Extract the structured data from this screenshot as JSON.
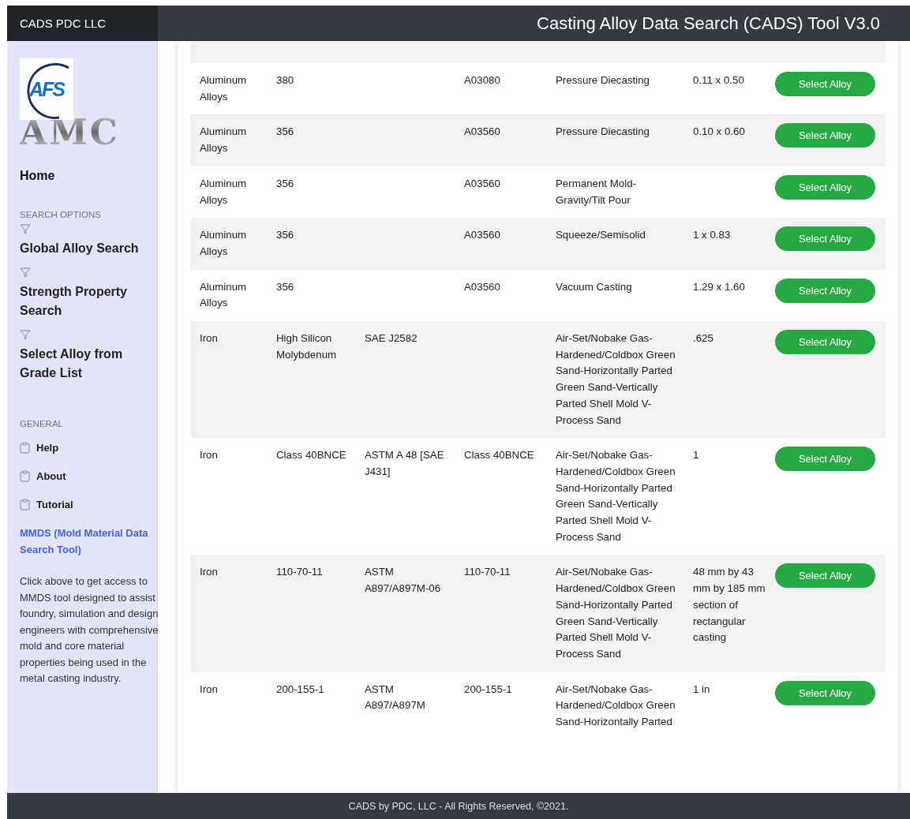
{
  "brand": "CADS PDC LLC",
  "title": "Casting Alloy Data Search (CADS) Tool V3.0",
  "logo": {
    "badge": "AFS",
    "wordmark": "AMC"
  },
  "sidebar": {
    "home": "Home",
    "sections": [
      {
        "heading": "SEARCH OPTIONS",
        "items": [
          {
            "label": "Global Alloy Search",
            "kind": "filter"
          },
          {
            "label": "Strength Property Search",
            "kind": "filter"
          },
          {
            "label": "Select Alloy from Grade List",
            "kind": "filter"
          }
        ]
      },
      {
        "heading": "GENERAL",
        "items": [
          {
            "label": "Help",
            "kind": "page"
          },
          {
            "label": "About",
            "kind": "page"
          },
          {
            "label": "Tutorial",
            "kind": "page"
          }
        ]
      }
    ],
    "link": "MMDS (Mold Material Data Search Tool)",
    "description": "Click above to get access to MMDS tool designed to assist foundry, simulation and design engineers with comprehensive mold and core material properties being used in the metal casting industry."
  },
  "table": {
    "rows": [
      {
        "cells": [
          "Aluminum Alloys",
          "380",
          null,
          "A03080",
          "Pressure Diecasting",
          "0.11 x 0.50"
        ],
        "action": "Select Alloy"
      },
      {
        "cells": [
          "Aluminum Alloys",
          "356",
          null,
          "A03560",
          "Pressure Diecasting",
          "0.10 x 0.60"
        ],
        "action": "Select Alloy"
      },
      {
        "cells": [
          "Aluminum Alloys",
          "356",
          null,
          "A03560",
          "Permanent Mold-Gravity/Tilt Pour",
          null
        ],
        "action": "Select Alloy"
      },
      {
        "cells": [
          "Aluminum Alloys",
          "356",
          null,
          "A03560",
          "Squeeze/Semisolid",
          "1 x 0.83"
        ],
        "action": "Select Alloy"
      },
      {
        "cells": [
          "Aluminum Alloys",
          "356",
          null,
          "A03560",
          "Vacuum Casting",
          "1.29 x 1.60"
        ],
        "action": "Select Alloy"
      },
      {
        "cells": [
          "Iron",
          "High Silicon Molybdenum",
          "SAE J2582",
          null,
          "Air-Set/Nobake Gas-Hardened/Coldbox Green Sand-Horizontally Parted Green Sand-Vertically Parted Shell Mold V-Process Sand",
          ".625"
        ],
        "action": "Select Alloy"
      },
      {
        "cells": [
          "Iron",
          "Class 40BNCE",
          "ASTM A 48 [SAE J431]",
          "Class 40BNCE",
          "Air-Set/Nobake Gas-Hardened/Coldbox Green Sand-Horizontally Parted Green Sand-Vertically Parted Shell Mold V-Process Sand",
          "1"
        ],
        "action": "Select Alloy"
      },
      {
        "cells": [
          "Iron",
          "110-70-11",
          "ASTM A897/A897M-06",
          "110-70-11",
          "Air-Set/Nobake Gas-Hardened/Coldbox Green Sand-Horizontally Parted Green Sand-Vertically Parted Shell Mold V-Process Sand",
          "48 mm by 43 mm by 185 mm section of rectangular casting"
        ],
        "action": "Select Alloy"
      },
      {
        "cells": [
          "Iron",
          "200-155-1",
          "ASTM A897/A897M",
          "200-155-1",
          "Air-Set/Nobake Gas-Hardened/Coldbox Green Sand-Horizontally Parted",
          "1 in"
        ],
        "action": "Select Alloy"
      }
    ]
  },
  "footer": "CADS by PDC, LLC - All Rights Reserved, ©2021."
}
